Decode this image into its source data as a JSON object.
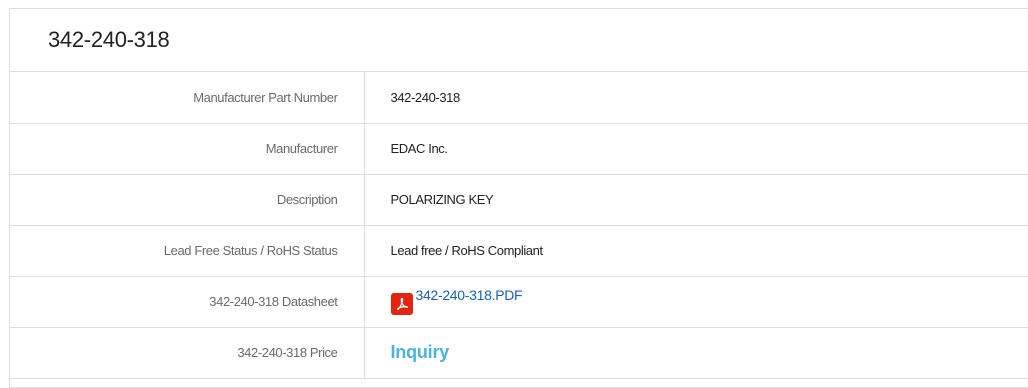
{
  "title": "342-240-318",
  "rows": [
    {
      "label": "Manufacturer Part Number",
      "value": "342-240-318"
    },
    {
      "label": "Manufacturer",
      "value": "EDAC Inc."
    },
    {
      "label": "Description",
      "value": "POLARIZING KEY"
    },
    {
      "label": "Lead Free Status / RoHS Status",
      "value": "Lead free / RoHS Compliant"
    },
    {
      "label": "342-240-318 Datasheet",
      "value": "342-240-318.PDF",
      "icon": "pdf-icon"
    },
    {
      "label": "342-240-318 Price",
      "value": "Inquiry"
    }
  ],
  "colors": {
    "pdf_icon": "#e3240f",
    "link": "#1a5fb4",
    "inquiry": "#4bb3e0",
    "border": "#dddddd"
  }
}
